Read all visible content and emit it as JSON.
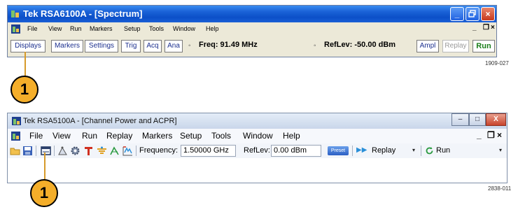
{
  "colors": {
    "xp_title": "#0b4fc8",
    "callout_fill": "#f4ae2a",
    "run_green": "#1a7e1a",
    "win7_title": "#dbe4f1"
  },
  "panel1": {
    "title": "Tek RSA6100A - [Spectrum]",
    "window_controls": [
      "_",
      "×"
    ],
    "menu": [
      "File",
      "View",
      "Run",
      "Markers",
      "Setup",
      "Tools",
      "Window",
      "Help"
    ],
    "menu_controls": [
      "_",
      "×"
    ],
    "toolbar": {
      "buttons": [
        "Displays",
        "Markers",
        "Settings",
        "Trig",
        "Acq",
        "Ana"
      ],
      "freq_label": "Freq: 91.49 MHz",
      "reflev_label": "RefLev: -50.00 dBm",
      "ampl": "Ampl",
      "replay": "Replay",
      "run": "Run"
    },
    "figure_id": "1909-027",
    "callout": "1"
  },
  "panel2": {
    "title": "Tek RSA5100A - [Channel Power and ACPR]",
    "window_controls": [
      "–",
      "□",
      "X"
    ],
    "menu": [
      "File",
      "View",
      "Run",
      "Replay",
      "Markers",
      "Setup",
      "Tools",
      "Window",
      "Help"
    ],
    "menu_controls": [
      "_",
      "×"
    ],
    "toolbar": {
      "frequency_label": "Frequency:",
      "frequency_value": "1.50000 GHz",
      "reflev_label": "RefLev:",
      "reflev_value": "0.00 dBm",
      "preset": "Preset",
      "replay": "Replay",
      "run": "Run"
    },
    "icons": [
      "open-folder-icon",
      "save-icon",
      "displays-icon",
      "markers-icon",
      "settings-gear-icon",
      "trigger-icon",
      "acquire-icon",
      "analysis-icon",
      "amplitude-icon"
    ],
    "figure_id": "2838-011",
    "callout": "1"
  }
}
